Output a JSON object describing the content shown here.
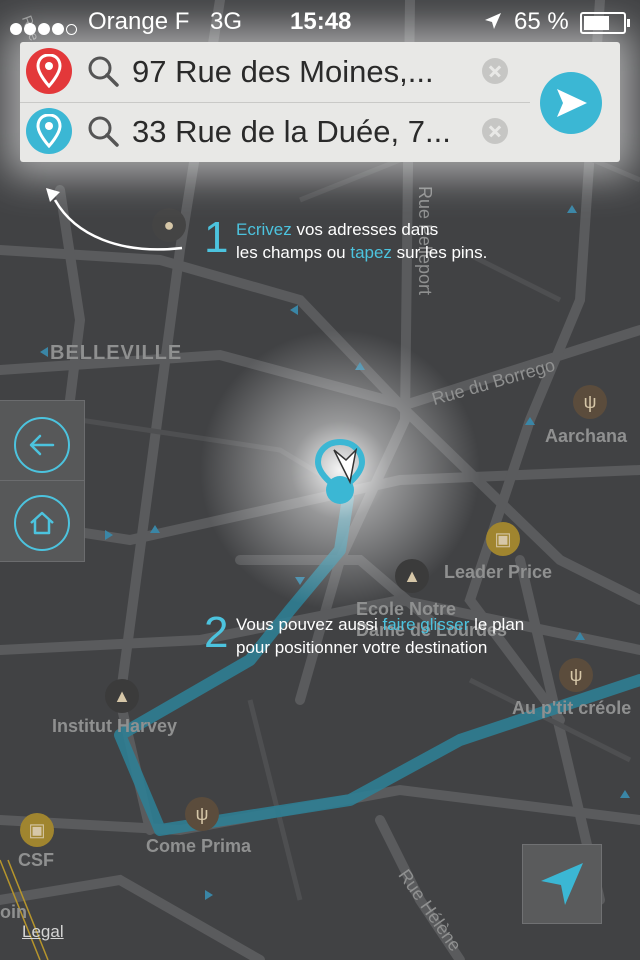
{
  "status_bar": {
    "carrier": "Orange F",
    "network": "3G",
    "time": "15:48",
    "battery": "65 %",
    "battery_level": 0.65
  },
  "search": {
    "origin_value": "97 Rue des Moines,...",
    "destination_value": "33 Rue de la Duée, 7...",
    "go_icon": "arrow-right-icon"
  },
  "tips": {
    "tip1_number": "1",
    "tip1_part1": "Ecrivez",
    "tip1_part2": " vos adresses dans",
    "tip1_part3": "les champs ou ",
    "tip1_part4": "tapez",
    "tip1_part5": " sur les pins.",
    "tip2_number": "2",
    "tip2_part1": "Vous pouvez aussi ",
    "tip2_part2": "faire glisser",
    "tip2_part3": " le plan",
    "tip2_part4": "pour positionner votre destination"
  },
  "map_labels": {
    "belleville": "BELLEVILLE",
    "rue_du_borrego": "Rue du Borrego",
    "rue_pelleport": "Rue Pelleport",
    "aarchana": "Aarchana",
    "leader_price": "Leader Price",
    "ecole_notre": "Ecole Notre",
    "dame_de_lourdes": "Dame de Lourdes",
    "institut_harvey": "Institut Harvey",
    "au_p_tit_creole": "Au p'tit créole",
    "come_prima": "Come Prima",
    "csf": "CSF",
    "rue_helene": "Rue Hélène",
    "rue_left": "Rue",
    "coin": "oin"
  },
  "footer": {
    "legal": "Legal"
  },
  "colors": {
    "accent": "#4cc3de",
    "route": "#2f7e93",
    "origin_pin": "#e3383a",
    "destination_pin": "#3bb7d4"
  }
}
